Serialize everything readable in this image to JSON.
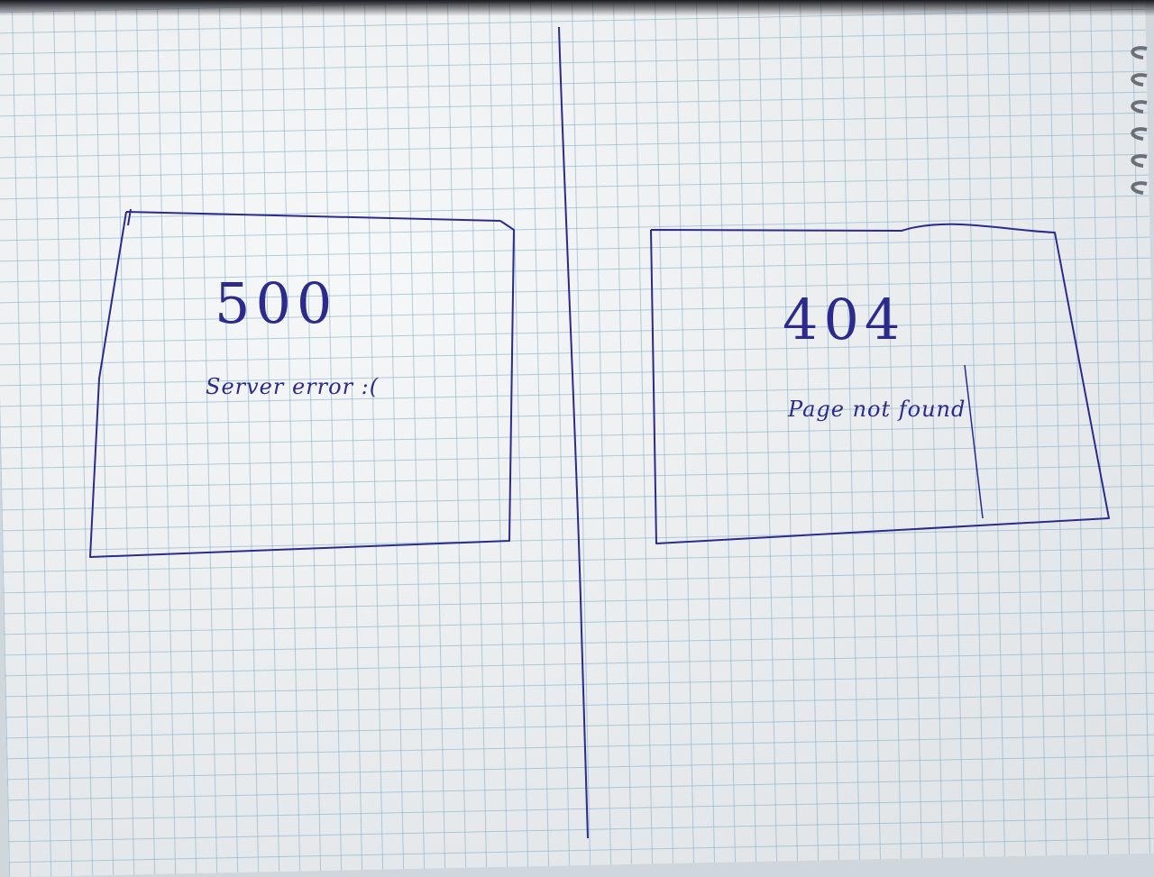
{
  "sketch": {
    "left_panel": {
      "code": "500",
      "message": "Server error :("
    },
    "right_panel": {
      "code": "404",
      "message": "Page not found"
    }
  },
  "colors": {
    "ink": "#2c2a8a",
    "grid": "#78aac8",
    "paper": "#e9ecee"
  }
}
